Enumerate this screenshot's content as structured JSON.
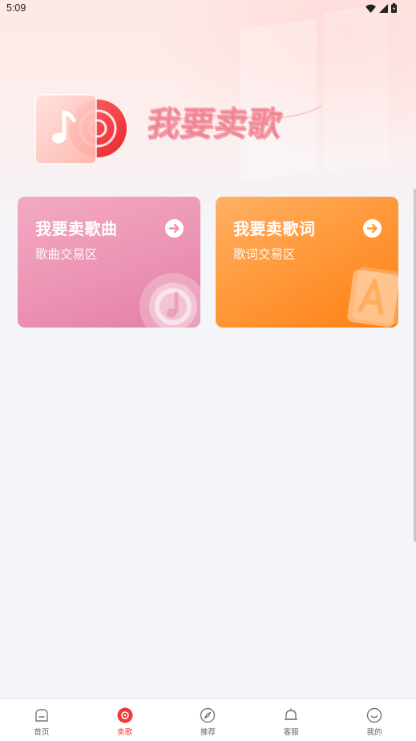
{
  "status_bar": {
    "time": "5:09"
  },
  "banner": {
    "title": "我要卖歌"
  },
  "cards": [
    {
      "title": "我要卖歌曲",
      "subtitle": "歌曲交易区"
    },
    {
      "title": "我要卖歌词",
      "subtitle": "歌词交易区"
    }
  ],
  "bottom_nav": {
    "items": [
      {
        "label": "首页",
        "icon": "home-icon"
      },
      {
        "label": "卖歌",
        "icon": "record-icon"
      },
      {
        "label": "推荐",
        "icon": "compass-icon"
      },
      {
        "label": "客服",
        "icon": "bell-icon"
      },
      {
        "label": "我的",
        "icon": "smile-icon"
      }
    ],
    "active_index": 1
  },
  "colors": {
    "accent": "#f03a3a",
    "song_card": "#ec93b4",
    "lyric_card": "#ff9a3c",
    "background": "#f4f5f9"
  }
}
